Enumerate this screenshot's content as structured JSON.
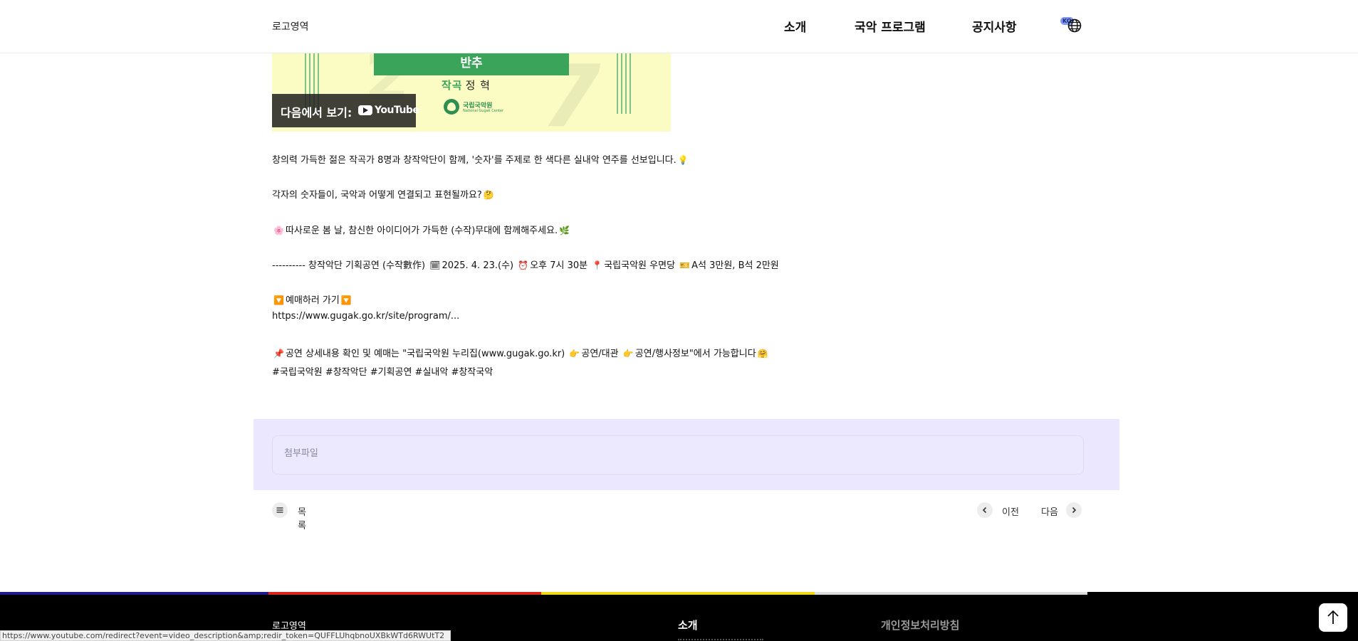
{
  "header": {
    "logo": "로고영역",
    "nav": [
      "소개",
      "국악 프로그램",
      "공지사항"
    ],
    "lang_badge": "KO"
  },
  "video": {
    "banner": "반추",
    "composer_label": "작곡",
    "composer_name": "정 혁",
    "org_name": "국립국악원",
    "org_name_en": "National Gugak Center",
    "watch_on": "다음에서 보기:",
    "youtube_word": "YouTube"
  },
  "description": {
    "line1": "창의력 가득한 젊은 작곡가 8명과 창작악단이 함께, '숫자'를 주제로 한 색다른 실내악 연주를 선보입니다.",
    "line2": "각자의 숫자들이, 국악과 어떻게 연결되고 표현될까요?",
    "line3": "따사로운 봄 날, 참신한 아이디어가 가득한 (수작)무대에 함께해주세요.",
    "line4_prefix": "---------- 창작악단 기획공연 (수작數作)",
    "line4_date": "2025. 4. 23.(수)",
    "line4_time": "오후 7시 30분",
    "line4_place": "국립국악원 우면당",
    "line4_price": "A석 3만원, B석 2만원",
    "line5": "예매하러 가기",
    "link": "https://www.gugak.go.kr/site/program/...",
    "line6_a": "공연 상세내용 확인 및 예매는 \"국립국악원 누리집(www.gugak.go.kr)",
    "line6_b": "공연/대관",
    "line6_c": "공연/행사정보\"에서 가능합니다",
    "hashtags": "#국립국악원 #창작악단 #기획공연 #실내악 #창작국악"
  },
  "attachment": {
    "label": "첨부파일"
  },
  "pagination": {
    "list_label": "목록",
    "prev_label": "이전",
    "next_label": "다음"
  },
  "footer": {
    "logo": "로고영역",
    "nav_item": "소개",
    "privacy": "개인정보처리방침"
  },
  "status_bar": {
    "url": "https://www.youtube.com/redirect?event=video_description&amp;redir_token=QUFFLUhqbnoUXBkWTd6RWUtT2"
  },
  "colors": {
    "accent_green": "#3aa55a",
    "attach_bg": "#eae7ff",
    "stripe_navy": "#1f1b8c",
    "stripe_red": "#d8261c",
    "stripe_yellow": "#f1d918",
    "stripe_gray": "#dddddd",
    "footer_bg": "#000000"
  },
  "icons": {
    "lang": "globe-icon",
    "list": "list-icon",
    "prev": "chevron-left-icon",
    "next": "chevron-right-icon",
    "top": "arrow-up-icon",
    "youtube": "youtube-play-icon"
  }
}
